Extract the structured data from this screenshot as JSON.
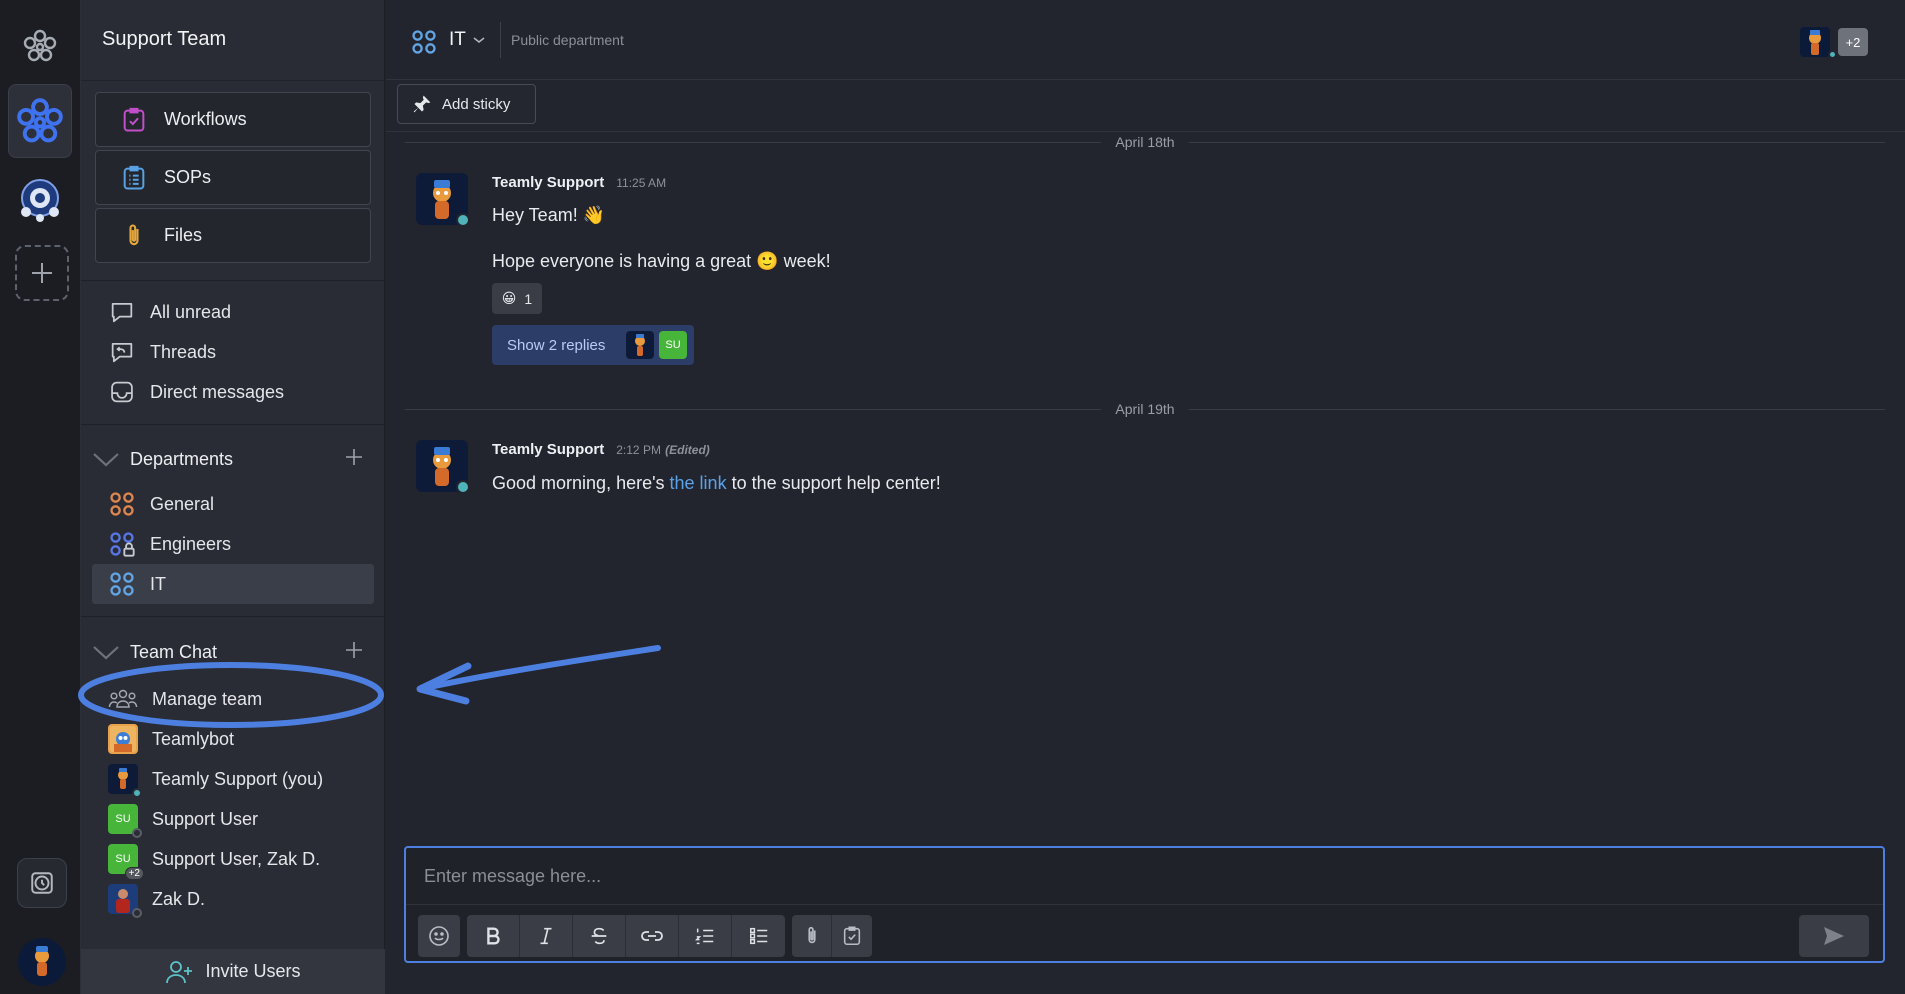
{
  "sidebar": {
    "title": "Support Team",
    "tools": [
      {
        "label": "Workflows"
      },
      {
        "label": "SOPs"
      },
      {
        "label": "Files"
      }
    ],
    "nav": [
      {
        "label": "All unread"
      },
      {
        "label": "Threads"
      },
      {
        "label": "Direct messages"
      }
    ],
    "departments": {
      "label": "Departments",
      "items": [
        {
          "label": "General"
        },
        {
          "label": "Engineers"
        },
        {
          "label": "IT"
        }
      ]
    },
    "team_chat": {
      "label": "Team Chat",
      "items": [
        {
          "label": "Manage team"
        },
        {
          "label": "Teamlybot"
        },
        {
          "label": "Teamly Support (you)"
        },
        {
          "label": "Support User",
          "avatar": "SU"
        },
        {
          "label": "Support User, Zak D.",
          "avatar": "SU",
          "extra": "+2"
        },
        {
          "label": "Zak D."
        }
      ]
    },
    "invite_label": "Invite Users"
  },
  "header": {
    "channel": "IT",
    "description": "Public department",
    "member_extra": "+2"
  },
  "toolbar": {
    "add_sticky": "Add sticky"
  },
  "messages": [
    {
      "date": "April 18th",
      "author": "Teamly Support",
      "time": "11:25 AM",
      "lines": [
        "Hey Team! 👋",
        "Hope everyone is having a great 🙂 week!"
      ],
      "reaction": {
        "emoji": "😀",
        "count": "1"
      },
      "replies_label": "Show 2 replies",
      "reply_avatar": "SU"
    },
    {
      "date": "April 19th",
      "author": "Teamly Support",
      "time": "2:12 PM",
      "edited": "(Edited)",
      "text_before": "Good morning, here's ",
      "link": "the link",
      "text_after": " to the support help center!"
    }
  ],
  "composer": {
    "placeholder": "Enter message here..."
  },
  "colors": {
    "accent": "#4c7fe0",
    "annotation": "#4c7fe0",
    "online": "#4fb3b9",
    "su_avatar": "#46b53a"
  }
}
